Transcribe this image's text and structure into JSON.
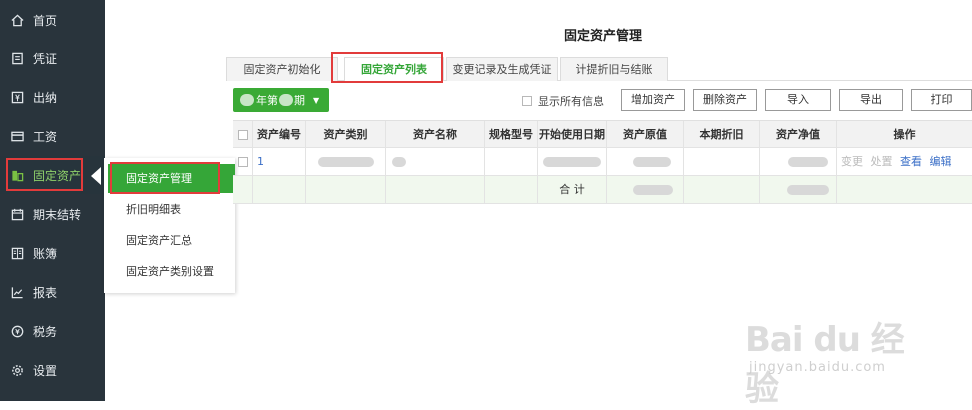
{
  "sidebar": {
    "items": [
      {
        "label": "首页",
        "icon": "home-icon"
      },
      {
        "label": "凭证",
        "icon": "voucher-icon"
      },
      {
        "label": "出纳",
        "icon": "cashier-icon"
      },
      {
        "label": "工资",
        "icon": "salary-card-icon"
      },
      {
        "label": "固定资产",
        "icon": "fixed-asset-icon",
        "active": true
      },
      {
        "label": "期末结转",
        "icon": "calendar-icon"
      },
      {
        "label": "账簿",
        "icon": "book-icon"
      },
      {
        "label": "报表",
        "icon": "chart-icon"
      },
      {
        "label": "税务",
        "icon": "tax-icon"
      },
      {
        "label": "设置",
        "icon": "gear-icon"
      }
    ]
  },
  "submenu": {
    "items": [
      {
        "label": "固定资产管理",
        "active": true
      },
      {
        "label": "折旧明细表"
      },
      {
        "label": "固定资产汇总"
      },
      {
        "label": "固定资产类别设置"
      }
    ]
  },
  "page": {
    "title": "固定资产管理"
  },
  "tabs": [
    {
      "label": "固定资产初始化"
    },
    {
      "label": "固定资产列表",
      "active": true
    },
    {
      "label": "变更记录及生成凭证"
    },
    {
      "label": "计提折旧与结账"
    }
  ],
  "toolbar": {
    "period_label_a": "年第",
    "period_label_b": "期",
    "show_all_label": "显示所有信息",
    "add_asset": "增加资产",
    "delete_asset": "删除资产",
    "import": "导入",
    "export": "导出",
    "print": "打印"
  },
  "table": {
    "headers": [
      "资产编号",
      "资产类别",
      "资产名称",
      "规格型号",
      "开始使用日期",
      "资产原值",
      "本期折旧",
      "资产净值",
      "操作"
    ],
    "rows": [
      {
        "asset_no": "1",
        "actions": {
          "change": "变更",
          "dispose": "处置",
          "view": "查看",
          "edit": "编辑"
        }
      }
    ],
    "total_label": "合 计"
  },
  "watermark": {
    "brand": "Bai du 经验",
    "url": "jingyan.baidu.com"
  },
  "colors": {
    "sidebar_bg": "#29343c",
    "accent_green": "#3aaa35",
    "highlight_red": "#e23b3b",
    "link_blue": "#3b6fc7"
  }
}
